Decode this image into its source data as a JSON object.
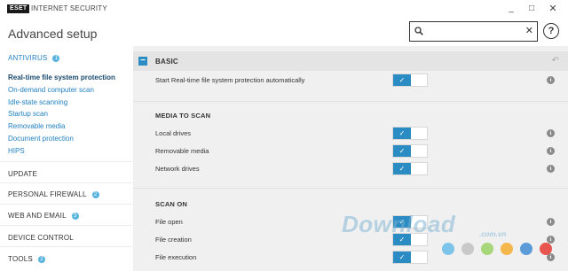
{
  "window": {
    "logo_text": "ESET",
    "product_name": "INTERNET SECURITY",
    "minimize_glyph": "_",
    "maximize_glyph": "□",
    "close_glyph": "✕"
  },
  "header": {
    "title": "Advanced setup",
    "search_value": "",
    "search_clear_glyph": "✕",
    "help_glyph": "?"
  },
  "sidebar": {
    "antivirus": {
      "label": "ANTIVIRUS",
      "badge": "1"
    },
    "subitems": [
      "Real-time file system protection",
      "On-demand computer scan",
      "Idle-state scanning",
      "Startup scan",
      "Removable media",
      "Document protection",
      "HIPS"
    ],
    "update": {
      "label": "UPDATE"
    },
    "firewall": {
      "label": "PERSONAL FIREWALL",
      "badge": "2"
    },
    "webmail": {
      "label": "WEB AND EMAIL",
      "badge": "3"
    },
    "device": {
      "label": "DEVICE CONTROL"
    },
    "tools": {
      "label": "TOOLS",
      "badge": "2"
    }
  },
  "main": {
    "section_label": "BASIC",
    "collapse_glyph": "−",
    "revert_glyph": "↶",
    "check_glyph": "✓",
    "info_glyph": "i",
    "start_row": "Start Real-time file system protection automatically",
    "media_title": "MEDIA TO SCAN",
    "media_rows": [
      "Local drives",
      "Removable media",
      "Network drives"
    ],
    "scan_title": "SCAN ON",
    "scan_rows": [
      "File open",
      "File creation",
      "File execution"
    ]
  },
  "watermark": {
    "text": "Download",
    "sub": ".com.vn",
    "dot_colors": [
      "#7dc4ea",
      "#c9c9c9",
      "#a8d67a",
      "#f5b74c",
      "#5a9bd8",
      "#e8554e"
    ]
  }
}
